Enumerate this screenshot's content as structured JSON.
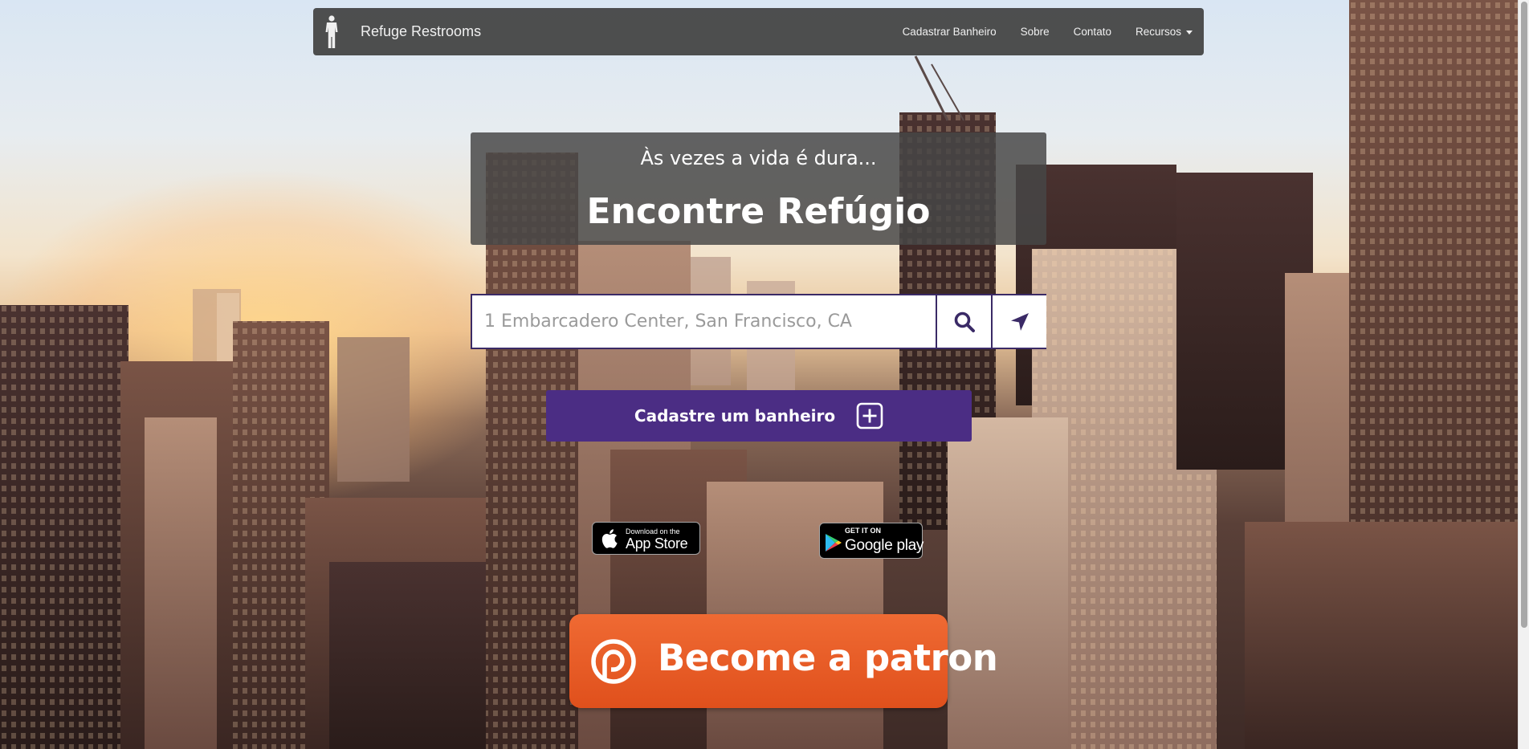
{
  "navbar": {
    "brand": "Refuge Restrooms",
    "items": [
      {
        "label": "Cadastrar Banheiro"
      },
      {
        "label": "Sobre"
      },
      {
        "label": "Contato"
      },
      {
        "label": "Recursos"
      }
    ]
  },
  "hero": {
    "tagline": "Às vezes a vida é dura...",
    "headline": "Encontre Refúgio"
  },
  "search": {
    "placeholder": "1 Embarcadero Center, San Francisco, CA",
    "value": "",
    "search_icon": "search-icon",
    "locate_icon": "location-arrow-icon"
  },
  "register": {
    "label": "Cadastre um banheiro",
    "icon": "plus-square-icon"
  },
  "apps": {
    "app_store": {
      "small": "Download on the",
      "large": "App Store"
    },
    "google_play": {
      "small": "GET IT ON",
      "large": "Google play"
    }
  },
  "patron": {
    "label": "Become a patron"
  },
  "colors": {
    "navbar": "#424242",
    "accent_purple": "#4b2d84",
    "search_border": "#3a2a66",
    "patreon_orange": "#e85b25"
  }
}
